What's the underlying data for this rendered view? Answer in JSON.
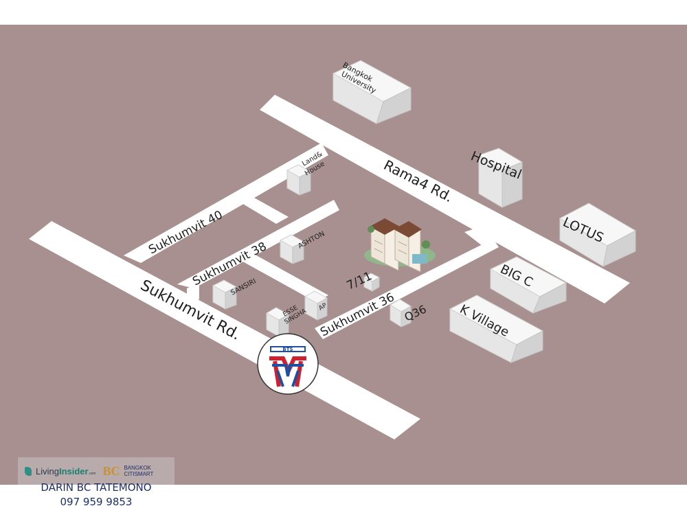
{
  "colors": {
    "background": "#a89090",
    "road": "#ffffff",
    "building": "#eeeeee",
    "bts_red": "#d0202e",
    "bts_blue": "#1f4fa0"
  },
  "roads": {
    "sukhumvit_rd": "Sukhumvit Rd.",
    "rama4_rd": "Rama4 Rd.",
    "sukhumvit_40": "Sukhumvit 40",
    "sukhumvit_38": "Sukhumvit 38",
    "sukhumvit_36": "Sukhumvit 36"
  },
  "landmarks": {
    "bangkok_university_1": "Bangkok",
    "bangkok_university_2": "University",
    "hospital": "Hospital",
    "lotus": "LOTUS",
    "big_c": "BIG C",
    "k_village": "K Village",
    "land_house_1": "Land&",
    "land_house_2": "House",
    "ashton": "ASHTON",
    "sansiri": "SANSIRI",
    "esse_1": "ESSE",
    "esse_2": "SINGHA",
    "ap": "AP",
    "seven_eleven": "7/11",
    "q36": "Q36"
  },
  "bts": {
    "label": "BTS",
    "icon": "bts-logo-icon"
  },
  "brand": {
    "living_insider_1": "Living",
    "living_insider_2": "Insider",
    "living_insider_dom": ".com",
    "bc_mark": "BC",
    "bc_name_1": "BANGKOK",
    "bc_name_2": "CITISMART"
  },
  "contact": {
    "name": "DARIN BC TATEMONO",
    "phone": "097 959 9853"
  }
}
